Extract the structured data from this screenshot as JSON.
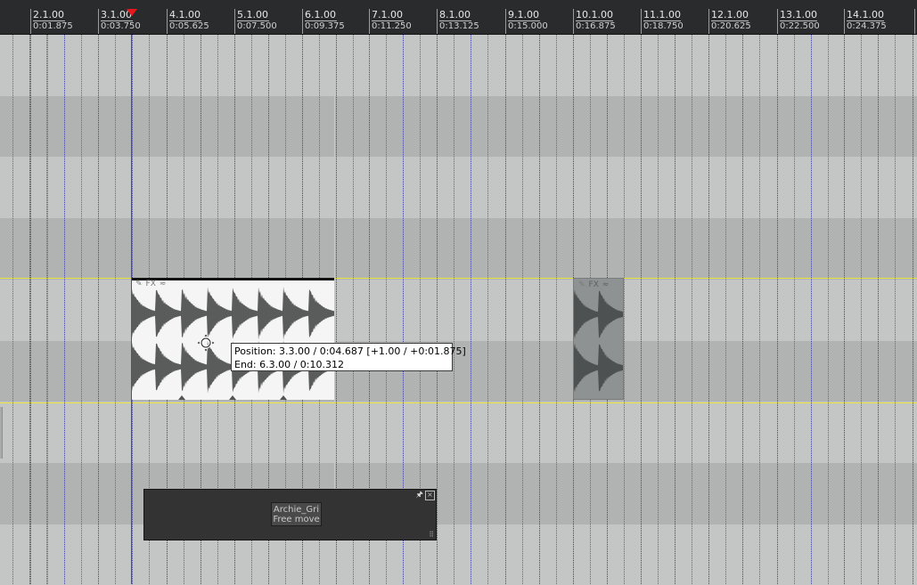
{
  "ruler": {
    "markers": [
      {
        "bar": "",
        "time": ""
      },
      {
        "bar": "2.1.00",
        "time": "0:01.875"
      },
      {
        "bar": "3.1.00",
        "time": "0:03.750"
      },
      {
        "bar": "4.1.00",
        "time": "0:05.625"
      },
      {
        "bar": "5.1.00",
        "time": "0:07.500"
      },
      {
        "bar": "6.1.00",
        "time": "0:09.375"
      },
      {
        "bar": "7.1.00",
        "time": "0:11.250"
      },
      {
        "bar": "8.1.00",
        "time": "0:13.125"
      },
      {
        "bar": "9.1.00",
        "time": "0:15.000"
      },
      {
        "bar": "10.1.00",
        "time": "0:16.875"
      },
      {
        "bar": "11.1.00",
        "time": "0:18.750"
      },
      {
        "bar": "12.1.00",
        "time": "0:20.625"
      },
      {
        "bar": "13.1.00",
        "time": "0:22.500"
      },
      {
        "bar": "14.1.00",
        "time": "0:24.375"
      }
    ]
  },
  "items": [
    {
      "fx_label": "FX"
    },
    {
      "fx_label": "FX"
    }
  ],
  "tooltip": {
    "line1": "Position: 3.3.00 / 0:04.687 [+1.00 / +0:01.875]",
    "line2": "End: 6.3.00 / 0:10.312"
  },
  "floating_window": {
    "button_line1": "Archie_Gri",
    "button_line2": "Free move",
    "pin_icon": "pin-icon",
    "close_icon": "close-icon",
    "close_symbol": "×",
    "pin_symbol": "🖈",
    "grip_symbol": "⠿"
  },
  "colors": {
    "background": "#c4c6c6",
    "lane_light": "#c4c6c6",
    "lane_dark": "#b1b3b3",
    "edit_cursor": "#e8171b",
    "selected_item_bg": "#f4f5f4",
    "waveform": "#5a5b5b",
    "ghost_item_bg": "#8e9292",
    "grid_beat": "#3c3cb4",
    "track_border": "#e8e63c"
  }
}
